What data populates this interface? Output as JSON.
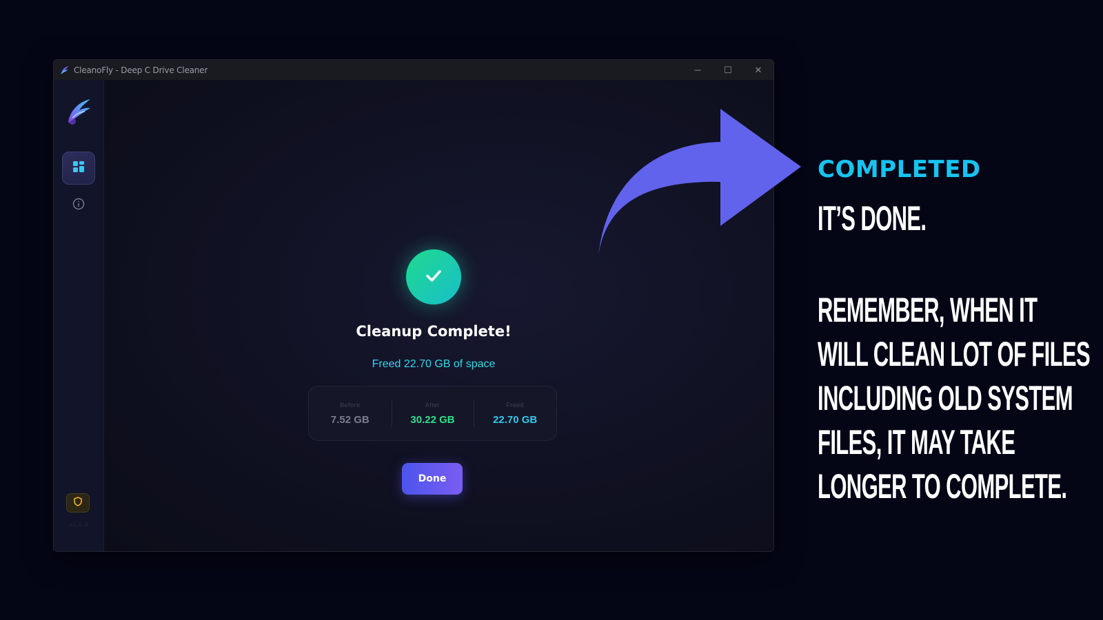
{
  "window": {
    "title": "CleanoFly - Deep C Drive Cleaner",
    "controls": {
      "minimize": "─",
      "maximize": "☐",
      "close": "✕"
    }
  },
  "sidebar": {
    "items": [
      {
        "name": "dashboard",
        "icon": "dashboard-grid-icon",
        "active": true
      },
      {
        "name": "about",
        "icon": "info-icon",
        "active": false
      }
    ],
    "bottom_badge_icon": "shield-icon",
    "version": "v1.0.0"
  },
  "main": {
    "status_icon": "checkmark-icon",
    "title": "Cleanup Complete!",
    "subtitle": "Freed 22.70 GB of space",
    "stats": [
      {
        "label": "Before",
        "value": "7.52 GB"
      },
      {
        "label": "After",
        "value": "30.22 GB"
      },
      {
        "label": "Freed",
        "value": "22.70 GB"
      }
    ],
    "done_label": "Done"
  },
  "annotation": {
    "heading": "COMPLETED",
    "line1": "IT’S DONE.",
    "body": "REMEMBER, WHEN IT WILL CLEAN LOT OF FILES INCLUDING OLD SYSTEM FILES, IT MAY TAKE LONGER TO COMPLETE.",
    "arrow_color": "#6163ec",
    "heading_color": "#18c3f0"
  }
}
